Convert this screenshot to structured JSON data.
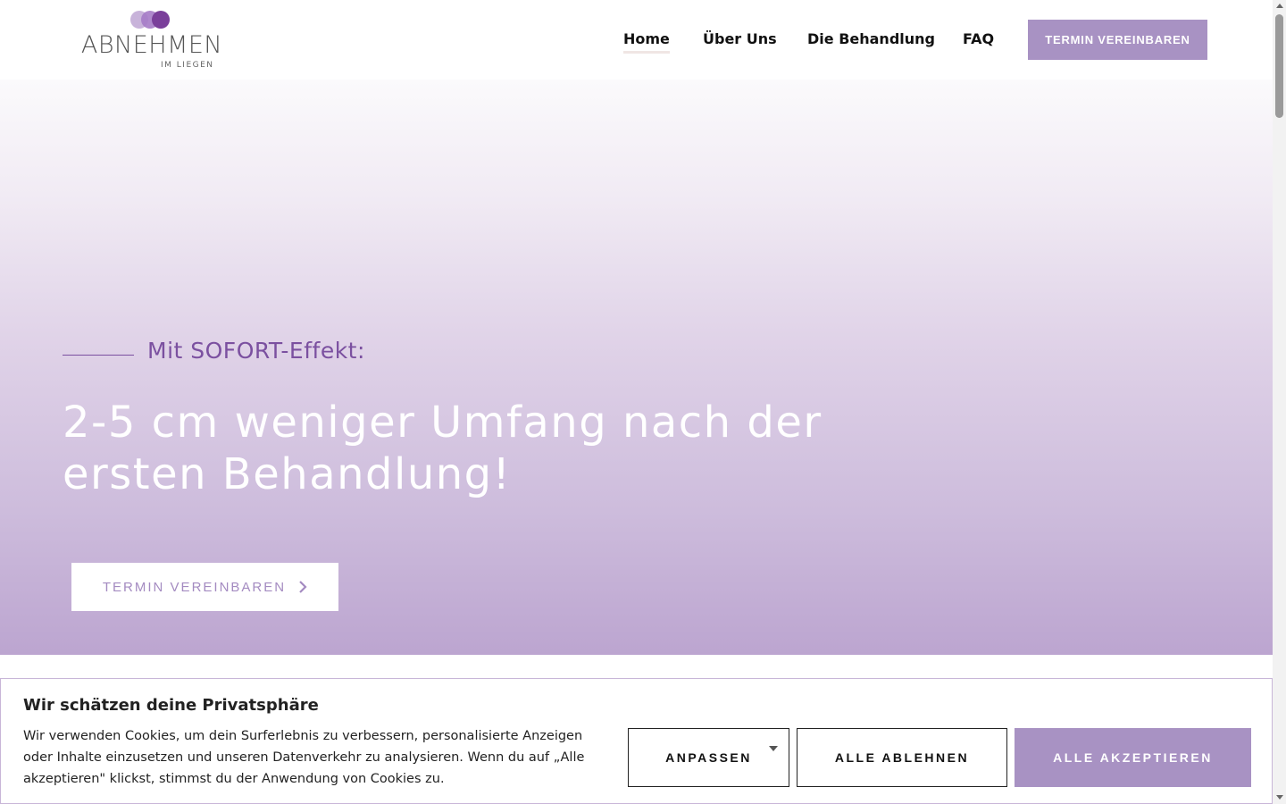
{
  "header": {
    "logo": {
      "main": "ABNEHMEN",
      "sub": "IM LIEGEN"
    },
    "nav": [
      {
        "label": "Home",
        "active": true
      },
      {
        "label": "Über Uns"
      },
      {
        "label": "Die Behandlung"
      },
      {
        "label": "FAQ"
      }
    ],
    "cta_label": "TERMIN VEREINBAREN"
  },
  "hero": {
    "kicker": "Mit SOFORT-Effekt:",
    "title": "2-5 cm weniger Umfang nach der ersten Behandlung!",
    "cta_label": "TERMIN VEREINBAREN",
    "cta_icon": "chevron-right-icon"
  },
  "cookie_banner": {
    "title": "Wir schätzen deine Privatsphäre",
    "text": "Wir verwenden Cookies, um dein Surferlebnis zu verbessern, personalisierte Anzeigen oder Inhalte einzusetzen und unseren Datenverkehr zu analysieren. Wenn du auf „Alle akzeptieren\" klickst, stimmst du der Anwendung von Cookies zu.",
    "customize_label": "ANPASSEN",
    "reject_label": "ALLE ABLEHNEN",
    "accept_label": "ALLE AKZEPTIEREN"
  },
  "colors": {
    "accent": "#a892c3",
    "kicker": "#7b50a0",
    "hero_top": "#fbfafc",
    "hero_bottom": "#bca5d0"
  }
}
